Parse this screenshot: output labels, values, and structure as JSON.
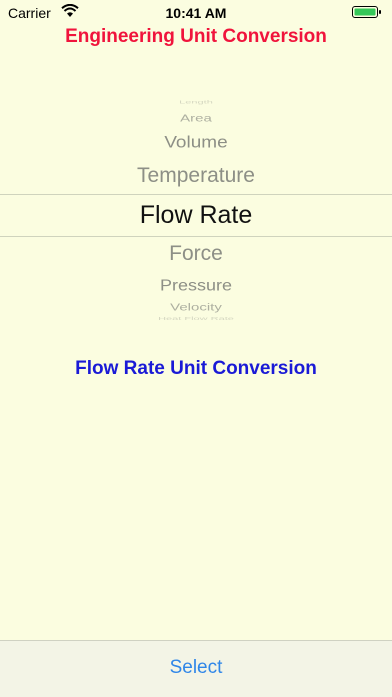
{
  "status_bar": {
    "carrier": "Carrier",
    "time": "10:41 AM"
  },
  "app": {
    "title": "Engineering Unit Conversion",
    "subtitle": "Flow Rate Unit Conversion"
  },
  "picker": {
    "items": [
      "Length",
      "Area",
      "Volume",
      "Temperature",
      "Flow Rate",
      "Force",
      "Pressure",
      "Velocity",
      "Heat Flow Rate"
    ],
    "selected": "Flow Rate"
  },
  "toolbar": {
    "select_label": "Select"
  },
  "colors": {
    "background": "#fbfde0",
    "title": "#f0143c",
    "subtitle": "#1a1ad6",
    "button": "#2f86e8"
  }
}
